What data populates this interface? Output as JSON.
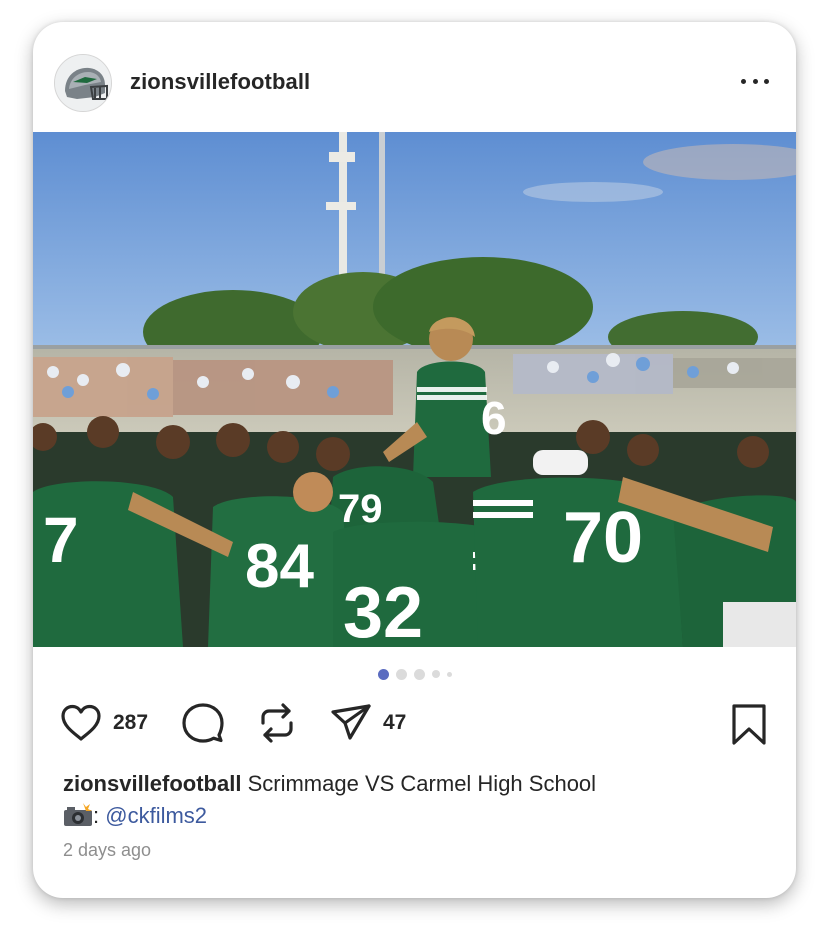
{
  "post": {
    "username": "zionsvillefootball",
    "more_icon": "more-horizontal-icon",
    "image_alt": "Zionsville football team huddled in green jerseys before a scrimmage",
    "jersey_numbers": [
      "6",
      "7",
      "84",
      "32",
      "70",
      "79"
    ],
    "carousel": {
      "count": 5,
      "active_index": 0
    },
    "likes": "287",
    "shares": "47",
    "caption": {
      "username": "zionsvillefootball",
      "text": "Scrimmage VS Carmel High School",
      "credit_sep": ":",
      "credit_mention": "@ckfilms2"
    },
    "timestamp": "2 days ago"
  },
  "colors": {
    "text": "#262626",
    "muted": "#8e8e8e",
    "mention": "#3d5a9e",
    "carousel_active": "#5b6cc0",
    "jersey_green": "#1f6a3e"
  }
}
